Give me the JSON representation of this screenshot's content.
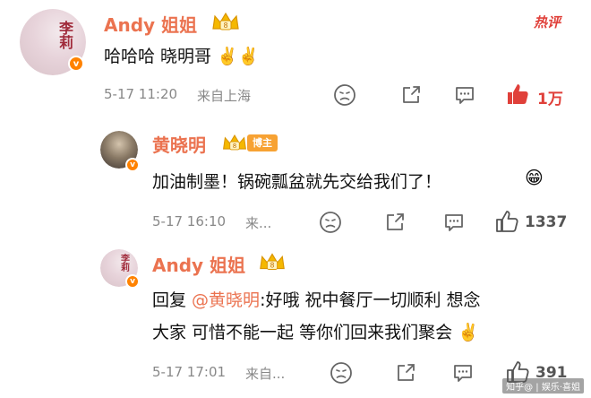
{
  "header": {
    "hot_tab": "热评"
  },
  "comments": [
    {
      "username": "Andy 姐姐",
      "avatar_text": "李莉",
      "avatar_badge": "v",
      "content": "哈哈哈 晓明哥 ✌️✌️",
      "time": "5-17 11:20",
      "location": "来自上海",
      "likes": "1万"
    },
    {
      "username": "黄晓明",
      "badge": "博主",
      "avatar_badge": "v",
      "content": "加油制墨！锅碗瓢盆就先交给我们了！",
      "emoji": "😁",
      "time": "5-17 16:10",
      "location": "来...",
      "likes": "1337"
    },
    {
      "username": "Andy 姐姐",
      "avatar_text": "李莉",
      "avatar_badge": "v",
      "reply_prefix": "回复 ",
      "mention": "@黄晓明",
      "content_line1": ":好哦 祝中餐厅一切顺利 想念",
      "content_line2": "大家 可惜不能一起 等你们回来我们聚会 ✌️",
      "time": "5-17 17:01",
      "location": "来自...",
      "likes": "391"
    }
  ],
  "watermark": "知乎@ | 娱乐·喜姐",
  "icons": [
    "meh-face-icon",
    "share-icon",
    "comment-icon",
    "thumbs-up-icon",
    "crown-icon",
    "peace-hand-icon"
  ],
  "colors": {
    "username": "#eb7350",
    "hot": "#e0403a",
    "crown": "#f5b800",
    "verified": "#ff8200"
  }
}
